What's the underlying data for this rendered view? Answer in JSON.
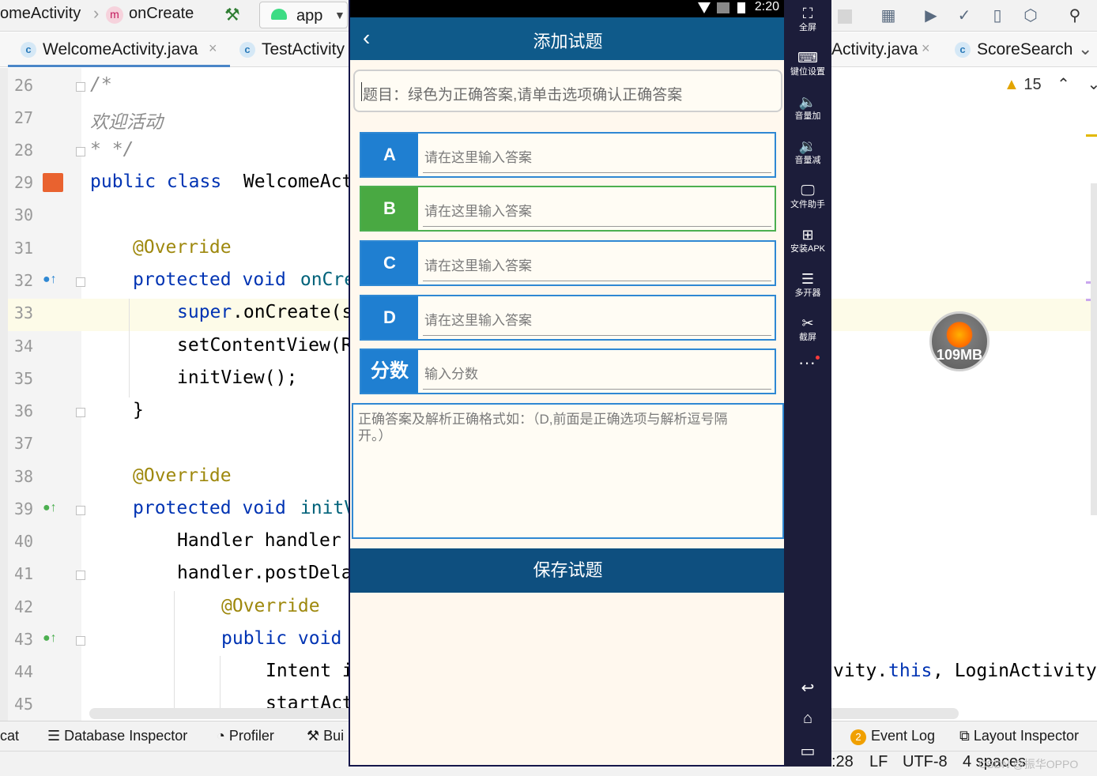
{
  "ide": {
    "breadcrumb": {
      "class_name": "omeActivity",
      "method_badge": "m",
      "method_name": "onCreate"
    },
    "run_config": "app",
    "tabs": [
      {
        "icon_letter": "c",
        "label": "WelcomeActivity.java",
        "close": "×"
      },
      {
        "icon_letter": "c",
        "label": "TestActivity"
      },
      {
        "label": "Activity.java",
        "close": "×"
      },
      {
        "icon_letter": "c",
        "label": "ScoreSearch"
      }
    ],
    "tab_overflow": "⌄",
    "inspections": {
      "count": "15",
      "up": "⌃",
      "down": "⌄"
    },
    "lines": [
      {
        "num": "26",
        "code": "/*"
      },
      {
        "num": "27",
        "code": "欢迎活动"
      },
      {
        "num": "28",
        "code": "* */"
      },
      {
        "num": "29",
        "kw": "public class",
        "code": " WelcomeActi"
      },
      {
        "num": "30",
        "code": ""
      },
      {
        "num": "31",
        "ann": "@Override"
      },
      {
        "num": "32",
        "kw": "protected void",
        "code2": " onCre"
      },
      {
        "num": "33",
        "kw": "super",
        "code": ".onCreate(s"
      },
      {
        "num": "34",
        "code": "setContentView(R"
      },
      {
        "num": "35",
        "code": "initView();"
      },
      {
        "num": "36",
        "code": "}"
      },
      {
        "num": "37",
        "code": ""
      },
      {
        "num": "38",
        "ann": "@Override"
      },
      {
        "num": "39",
        "kw": "protected void",
        "code2": " initV"
      },
      {
        "num": "40",
        "code": "Handler handler"
      },
      {
        "num": "41",
        "code": "handler.postDela"
      },
      {
        "num": "42",
        "ann": "@Override"
      },
      {
        "num": "43",
        "kw": "public void",
        "code": ""
      },
      {
        "num": "44",
        "code": "Intent i",
        "right_pre": "vity.",
        "right_kw": "this",
        "right_post": ", LoginActivity"
      },
      {
        "num": "45",
        "code": "startAct"
      }
    ],
    "bottom_tools": [
      "cat",
      "Database Inspector",
      "Profiler",
      "Bui"
    ],
    "right_tools": {
      "event_log_count": "2",
      "event_log": "Event Log",
      "layout_inspector": "Layout Inspector"
    },
    "status": {
      "position": ":28",
      "line_sep": "LF",
      "encoding": "UTF-8",
      "indent": "4 spaces"
    },
    "watermark": "CSDN @振华OPPO",
    "memory": "109MB"
  },
  "emulator": {
    "items": [
      {
        "icon": "⛶",
        "label": "全屏"
      },
      {
        "icon": "⌨",
        "label": "键位设置"
      },
      {
        "icon": "🔈",
        "label": "音量加"
      },
      {
        "icon": "🔉",
        "label": "音量减"
      },
      {
        "icon": "🖵",
        "label": "文件助手"
      },
      {
        "icon": "⊞",
        "label": "安装APK"
      },
      {
        "icon": "☰",
        "label": "多开器"
      },
      {
        "icon": "✂",
        "label": "截屏"
      }
    ],
    "more": "···",
    "nav": {
      "back": "↩",
      "home": "⌂",
      "recent": "▭"
    }
  },
  "phone": {
    "status_time": "2:20",
    "title": "添加试题",
    "back": "‹",
    "question_placeholder": "题目：绿色为正确答案,请单击选项确认正确答案",
    "options": [
      {
        "key": "A",
        "placeholder": "请在这里输入答案",
        "correct": false
      },
      {
        "key": "B",
        "placeholder": "请在这里输入答案",
        "correct": true
      },
      {
        "key": "C",
        "placeholder": "请在这里输入答案",
        "correct": false
      },
      {
        "key": "D",
        "placeholder": "请在这里输入答案",
        "correct": false
      }
    ],
    "score": {
      "key": "分数",
      "placeholder": "输入分数"
    },
    "explain_placeholder": "正确答案及解析正确格式如：（D,前面是正确选项与解析逗号隔开。）",
    "save_label": "保存试题"
  },
  "colors": {
    "title_bar": "#0f5a8a",
    "option_blue": "#1f7fd1",
    "option_green": "#49a942",
    "save_bar": "#0e4f7f",
    "emulator_panel": "#1c1d3a"
  }
}
